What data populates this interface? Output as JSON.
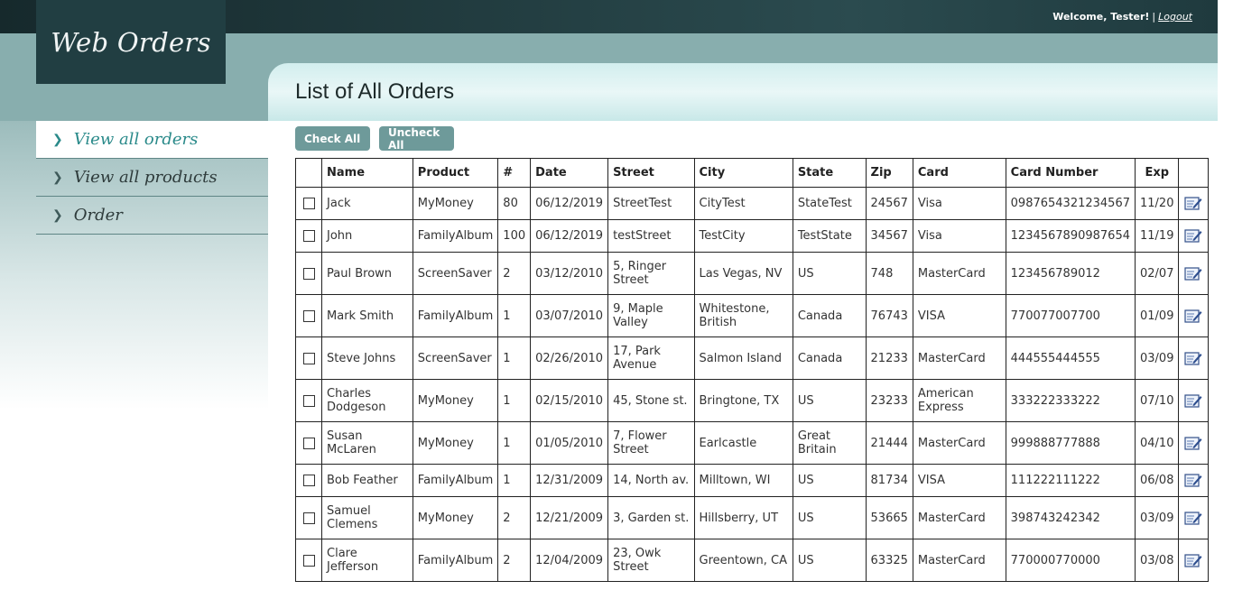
{
  "header": {
    "welcome": "Welcome, Tester!",
    "separator": "|",
    "logout": "Logout"
  },
  "logo": "Web Orders",
  "nav": {
    "items": [
      {
        "label": "View all orders",
        "active": true
      },
      {
        "label": "View all products",
        "active": false
      },
      {
        "label": "Order",
        "active": false
      }
    ]
  },
  "page_title": "List of All Orders",
  "buttons": {
    "check_all": "Check All",
    "uncheck_all": "Uncheck All"
  },
  "table": {
    "columns": [
      "Name",
      "Product",
      "#",
      "Date",
      "Street",
      "City",
      "State",
      "Zip",
      "Card",
      "Card Number",
      "Exp"
    ],
    "rows": [
      [
        "Jack",
        "MyMoney",
        "80",
        "06/12/2019",
        "StreetTest",
        "CityTest",
        "StateTest",
        "24567",
        "Visa",
        "0987654321234567",
        "11/20"
      ],
      [
        "John",
        "FamilyAlbum",
        "100",
        "06/12/2019",
        "testStreet",
        "TestCity",
        "TestState",
        "34567",
        "Visa",
        "1234567890987654",
        "11/19"
      ],
      [
        "Paul Brown",
        "ScreenSaver",
        "2",
        "03/12/2010",
        "5, Ringer Street",
        "Las Vegas, NV",
        "US",
        "748",
        "MasterCard",
        "123456789012",
        "02/07"
      ],
      [
        "Mark Smith",
        "FamilyAlbum",
        "1",
        "03/07/2010",
        "9, Maple Valley",
        "Whitestone, British",
        "Canada",
        "76743",
        "VISA",
        "770077007700",
        "01/09"
      ],
      [
        "Steve Johns",
        "ScreenSaver",
        "1",
        "02/26/2010",
        "17, Park Avenue",
        "Salmon Island",
        "Canada",
        "21233",
        "MasterCard",
        "444555444555",
        "03/09"
      ],
      [
        "Charles Dodgeson",
        "MyMoney",
        "1",
        "02/15/2010",
        "45, Stone st.",
        "Bringtone, TX",
        "US",
        "23233",
        "American Express",
        "333222333222",
        "07/10"
      ],
      [
        "Susan McLaren",
        "MyMoney",
        "1",
        "01/05/2010",
        "7, Flower Street",
        "Earlcastle",
        "Great Britain",
        "21444",
        "MasterCard",
        "999888777888",
        "04/10"
      ],
      [
        "Bob Feather",
        "FamilyAlbum",
        "1",
        "12/31/2009",
        "14, North av.",
        "Milltown, WI",
        "US",
        "81734",
        "VISA",
        "111222111222",
        "06/08"
      ],
      [
        "Samuel Clemens",
        "MyMoney",
        "2",
        "12/21/2009",
        "3, Garden st.",
        "Hillsberry, UT",
        "US",
        "53665",
        "MasterCard",
        "398743242342",
        "03/09"
      ],
      [
        "Clare Jefferson",
        "FamilyAlbum",
        "2",
        "12/04/2009",
        "23, Owk Street",
        "Greentown, CA",
        "US",
        "63325",
        "MasterCard",
        "770000770000",
        "03/08"
      ]
    ]
  },
  "icons": {
    "edit": "edit-icon",
    "nav_chevron": "chevron-right-icon"
  },
  "colors": {
    "topbar": "#1f3a3e",
    "band": "#88aeae",
    "accent": "#2a8a8a",
    "button": "#6e9a9a"
  }
}
